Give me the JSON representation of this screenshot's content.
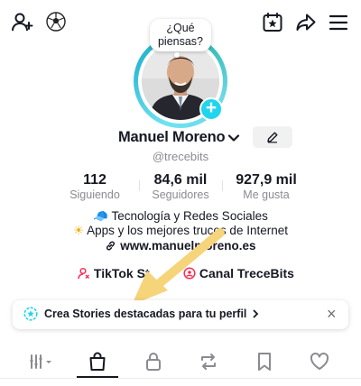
{
  "header": {
    "icons": [
      "add-user-icon",
      "soccer-ball-icon",
      "calendar-star-icon",
      "share-icon",
      "menu-icon"
    ]
  },
  "profile": {
    "bubble_text_line1": "¿Qué",
    "bubble_text_line2": "piensas?",
    "name": "Manuel Moreno",
    "username": "@trecebits",
    "avatar_badge": "+"
  },
  "stats": [
    {
      "value": "112",
      "label": "Siguiendo"
    },
    {
      "value": "84,6 mil",
      "label": "Seguidores"
    },
    {
      "value": "927,9 mil",
      "label": "Me gusta"
    }
  ],
  "bio": {
    "line1": "Tecnología y Redes Sociales",
    "line2": "Apps y los mejores trucos de Internet",
    "link": "www.manuelmoreno.es"
  },
  "links": {
    "tiktok_studio": "TikTok St",
    "canal": "Canal TreceBits"
  },
  "banner": {
    "text": "Crea Stories destacadas para tu perfil",
    "close_symbol": "×"
  },
  "tabs": [
    "grid-icon",
    "shopping-bag-icon",
    "lock-icon",
    "repost-icon",
    "bookmark-icon",
    "heart-icon"
  ],
  "colors": {
    "accent": "#20d5ec",
    "text": "#161823",
    "muted": "#8a8b91",
    "arrow": "#f6d47a",
    "pink": "#fe2c55"
  }
}
